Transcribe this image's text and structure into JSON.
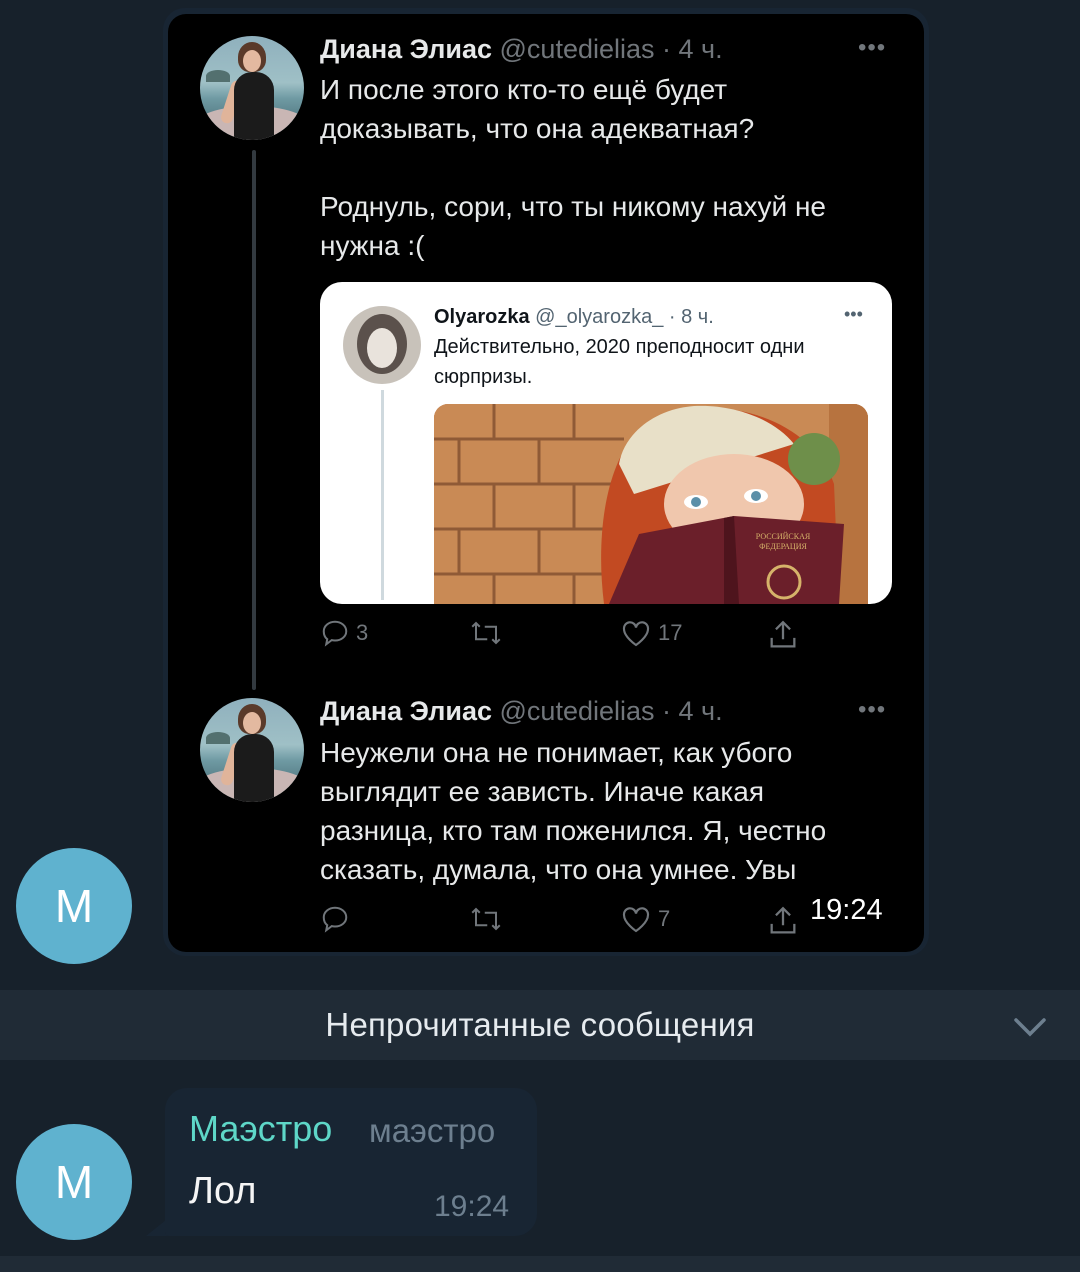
{
  "colors": {
    "bg": "#17212b",
    "avatar": "#5fb2cf",
    "author": "#5ed7c8",
    "meta": "#6d7f8f",
    "bubble": "#182533"
  },
  "chat": {
    "avatar1_letter": "M",
    "avatar2_letter": "M",
    "screenshot_time": "19:24",
    "unread_label": "Непрочитанные сообщения",
    "message": {
      "author": "Маэстро",
      "author_title": "маэстро",
      "text": "Лол",
      "time": "19:24"
    }
  },
  "tweet1": {
    "name": "Диана Элиас",
    "handle": "@cutedielias · 4 ч.",
    "text": "И после этого кто-то ещё будет\nдоказывать, что она адекватная?\n\nРоднуль, сори, что ты никому нахуй не\nнужна :(",
    "replies": "3",
    "likes": "17",
    "quote": {
      "name": "Olyarozka",
      "handle": "@_olyarozka_ · 8 ч.",
      "text": "Действительно, 2020 преподносит одни сюрпризы.",
      "passport_text": "РОССИЙСКАЯ ФЕДЕРАЦИЯ"
    }
  },
  "tweet2": {
    "name": "Диана Элиас",
    "handle": "@cutedielias · 4 ч.",
    "text": "Неужели она не понимает, как убого\nвыглядит ее зависть. Иначе какая\nразница, кто там поженился. Я, честно\nсказать, думала, что она умнее. Увы",
    "likes": "7"
  },
  "icons": [
    "reply-icon",
    "retweet-icon",
    "like-icon",
    "share-icon",
    "more-dots-icon",
    "chevron-down-icon"
  ]
}
